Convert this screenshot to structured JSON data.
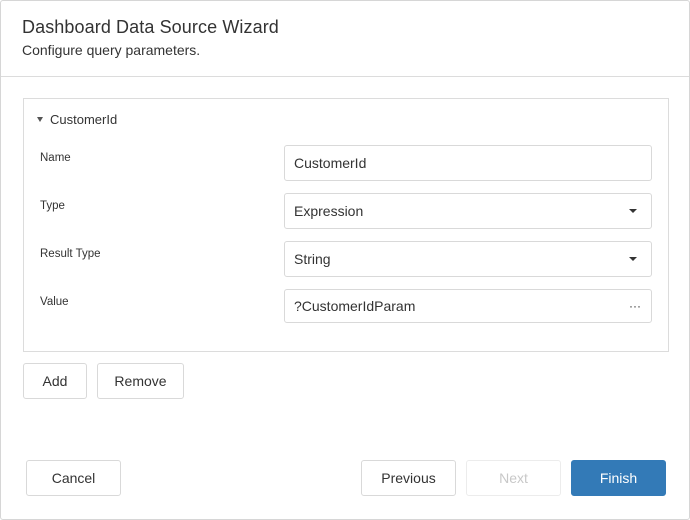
{
  "wizard": {
    "title": "Dashboard Data Source Wizard",
    "subtitle": "Configure query parameters."
  },
  "parameter": {
    "group_title": "CustomerId",
    "fields": {
      "name": {
        "label": "Name",
        "value": "CustomerId"
      },
      "type": {
        "label": "Type",
        "value": "Expression"
      },
      "result_type": {
        "label": "Result Type",
        "value": "String"
      },
      "value": {
        "label": "Value",
        "value": "?CustomerIdParam",
        "browse_glyph": "···"
      }
    }
  },
  "parameter_actions": {
    "add_label": "Add",
    "remove_label": "Remove"
  },
  "footer": {
    "cancel_label": "Cancel",
    "previous_label": "Previous",
    "next_label": "Next",
    "finish_label": "Finish"
  },
  "colors": {
    "primary": "#337ab7",
    "border": "#d9d9d9",
    "disabled_text": "#c8c8c8"
  }
}
